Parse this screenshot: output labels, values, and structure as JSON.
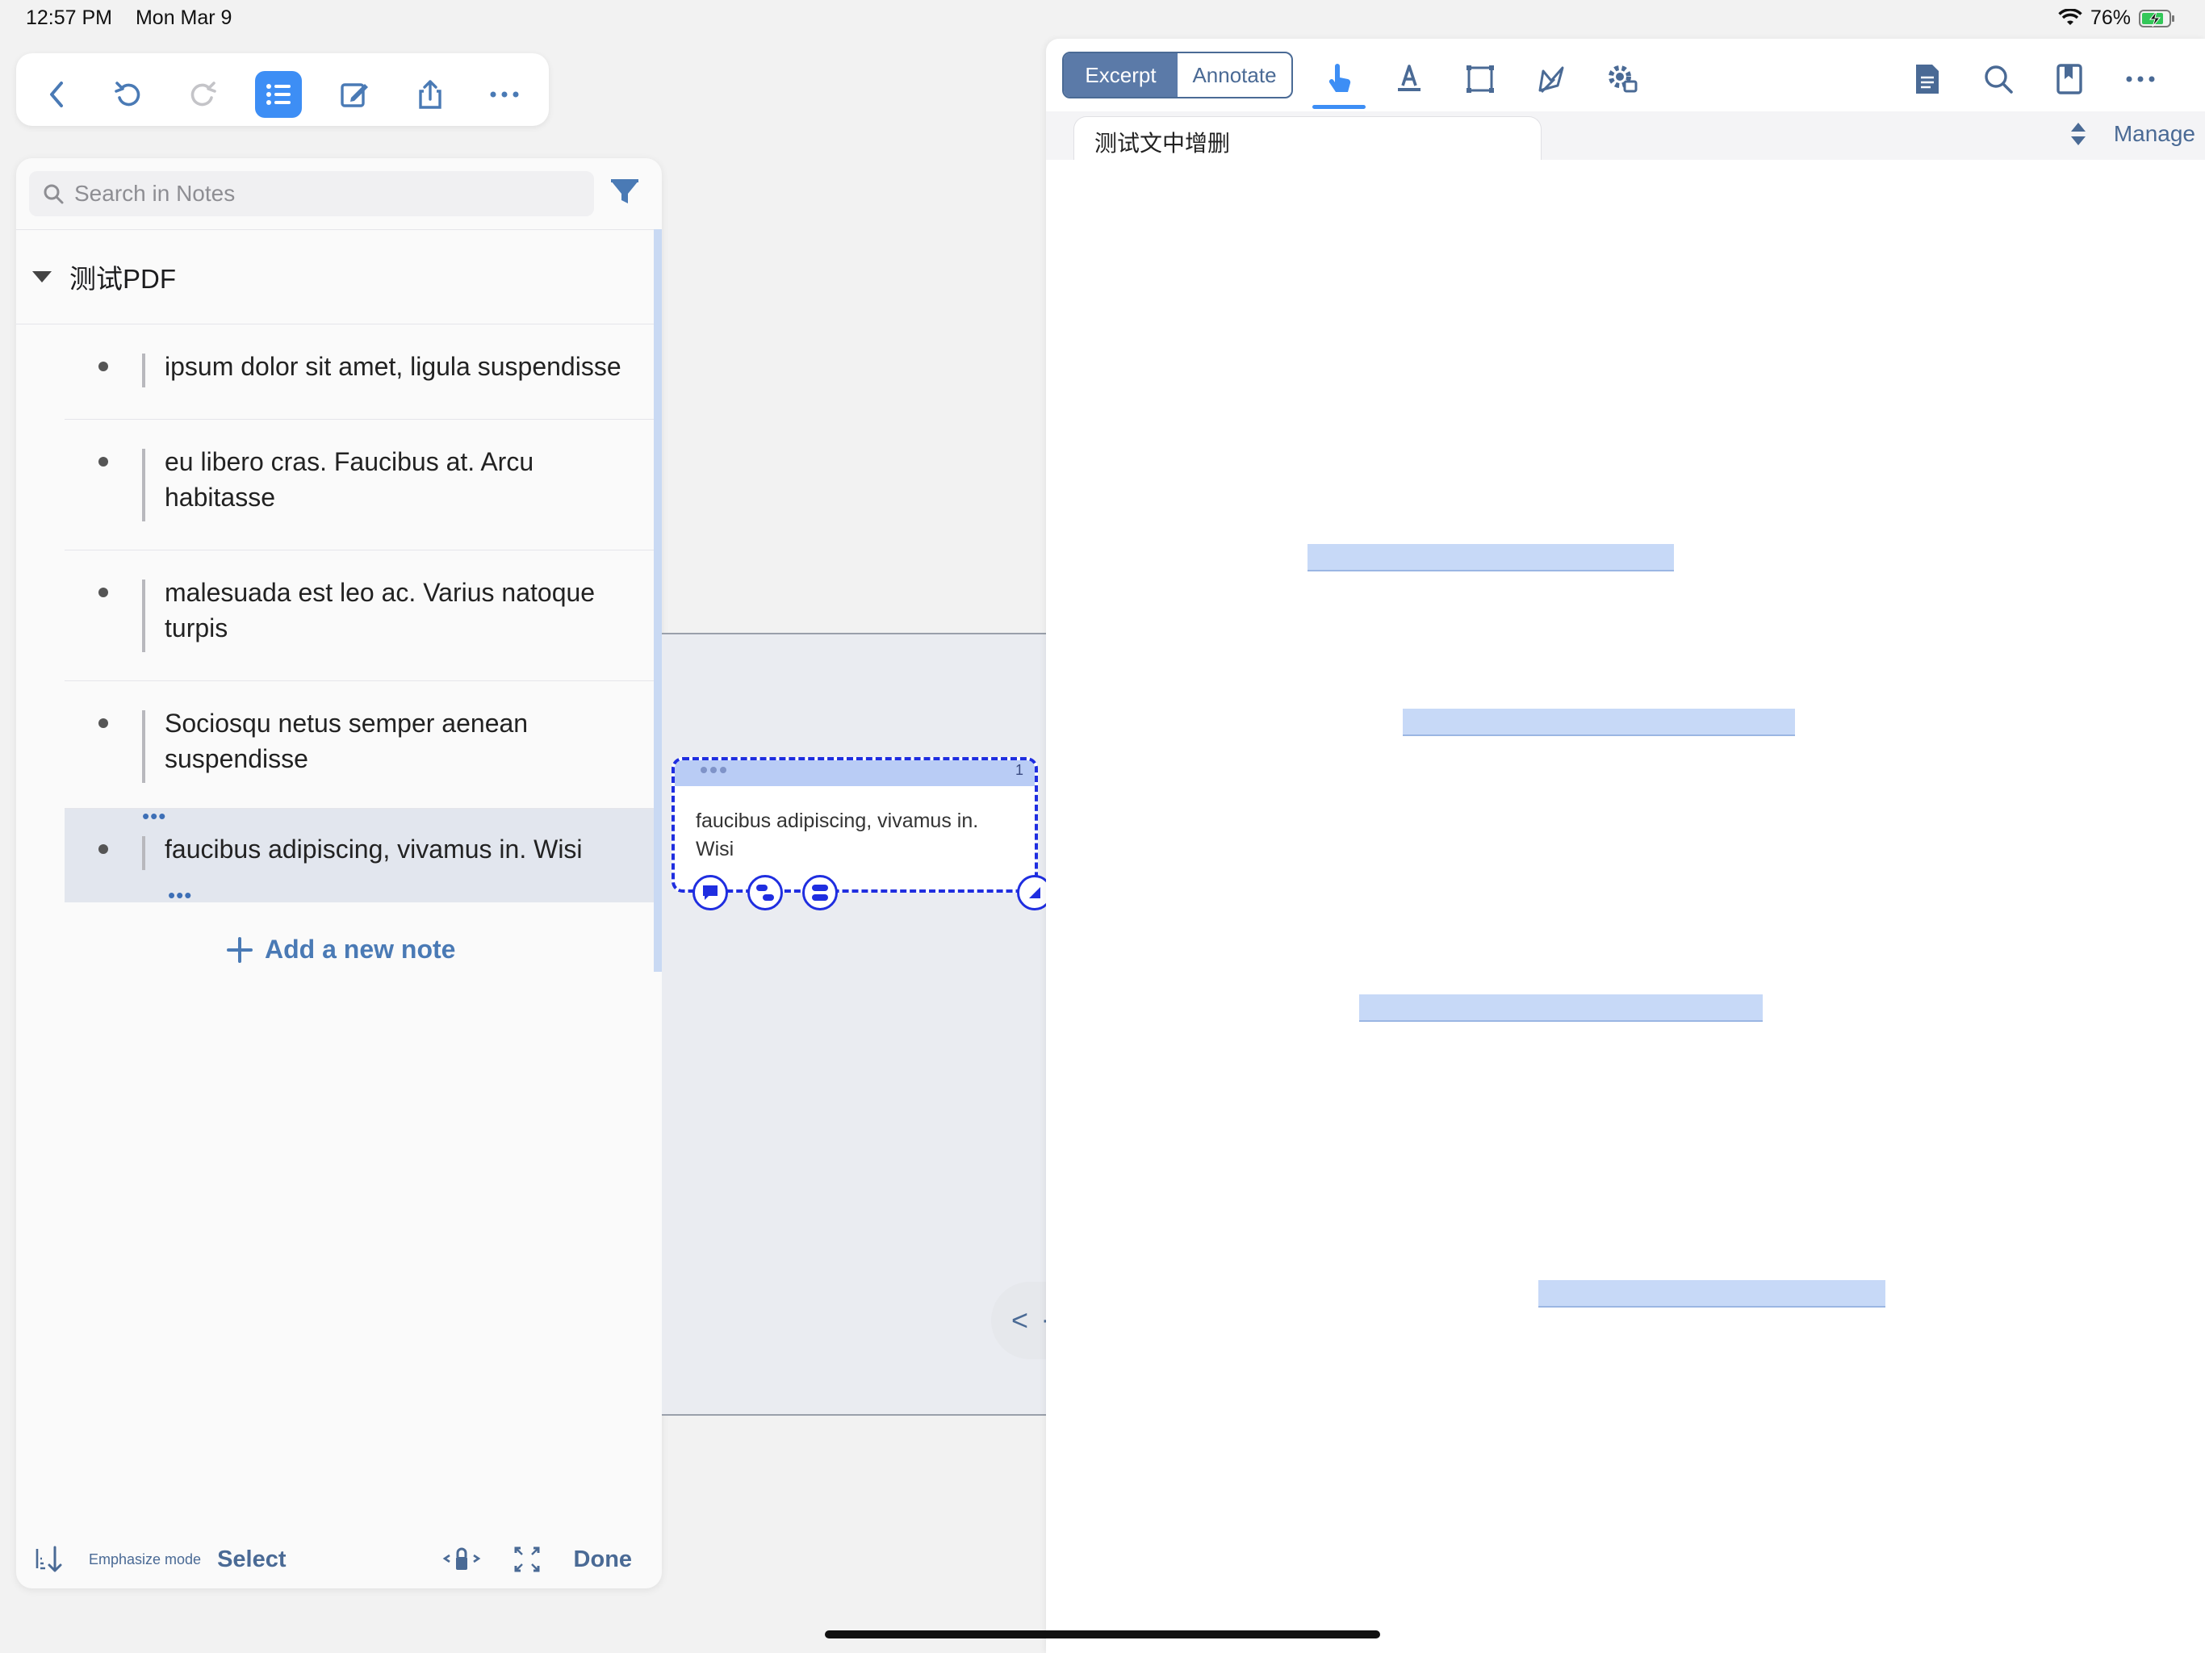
{
  "status": {
    "time": "12:57 PM",
    "date": "Mon Mar 9",
    "battery": "76%",
    "icons": [
      "wifi-icon",
      "battery-charging-icon"
    ]
  },
  "toolbar": {
    "items": [
      "back-icon",
      "undo-icon",
      "redo-icon",
      "outline-list-icon",
      "edit-icon",
      "share-icon",
      "more-icon"
    ],
    "active": "outline-list-icon",
    "accent": "#3d8ef5"
  },
  "notes": {
    "search_placeholder": "Search in Notes",
    "group_title": "测试PDF",
    "items": [
      {
        "text": "ipsum dolor sit amet, ligula suspendisse"
      },
      {
        "text": "eu libero cras. Faucibus at. Arcu habitasse"
      },
      {
        "text": "malesuada est leo ac. Varius natoque turpis"
      },
      {
        "text": "Sociosqu netus semper aenean suspendisse"
      },
      {
        "text": "faucibus adipiscing, vivamus in. Wisi"
      }
    ],
    "selected_index": 4,
    "add_label": "Add a new note",
    "bottom": {
      "emphasize": "Emphasize mode",
      "select": "Select",
      "done": "Done"
    }
  },
  "card": {
    "text": "faucibus adipiscing, vivamus in. Wisi",
    "number": "1",
    "border_color": "#1f2ee0"
  },
  "document": {
    "modes": [
      "Excerpt",
      "Annotate"
    ],
    "active_mode": "Excerpt",
    "tools": [
      "hand-pointer-icon",
      "text-highlight-icon",
      "rectangle-select-icon",
      "lasso-icon",
      "settings-gear-icon"
    ],
    "right_tools": [
      "document-icon",
      "search-icon",
      "bookmark-icon",
      "more-icon"
    ],
    "tab_title": "测试文中增删",
    "manage": "Manage",
    "highlight_color": "#c7d9f7"
  },
  "nav": {
    "prev": "<",
    "dot": "·",
    "next": ">"
  }
}
